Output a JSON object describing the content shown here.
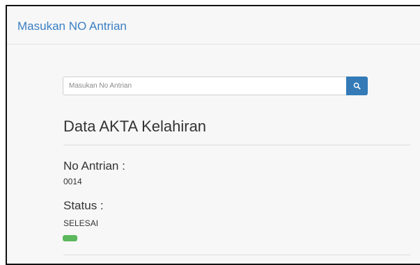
{
  "panel": {
    "title": "Masukan NO Antrian"
  },
  "search": {
    "placeholder": "Masukan No Antrian",
    "value": "",
    "icon": "search-icon"
  },
  "section": {
    "title": "Data AKTA Kelahiran"
  },
  "fields": {
    "antrian_label": "No Antrian :",
    "antrian_value": "0014",
    "status_label": "Status :",
    "status_value": "SELESAI"
  },
  "colors": {
    "accent": "#337ab7",
    "title_link": "#3a7fc3",
    "status_success": "#5cb85c"
  }
}
